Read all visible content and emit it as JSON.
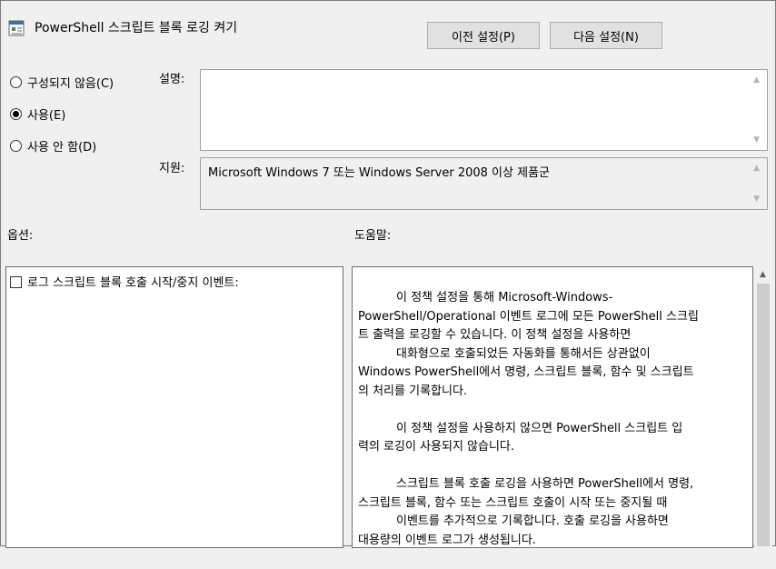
{
  "window": {
    "title": "PowerShell 스크립트 블록 로깅 켜기"
  },
  "nav": {
    "prev_label": "이전 설정(P)",
    "next_label": "다음 설정(N)"
  },
  "state": {
    "options": [
      {
        "label": "구성되지 않음(C)",
        "selected": false
      },
      {
        "label": "사용(E)",
        "selected": true
      },
      {
        "label": "사용 안 함(D)",
        "selected": false
      }
    ]
  },
  "description": {
    "label": "설명:",
    "value": ""
  },
  "support": {
    "label": "지원:",
    "value": "Microsoft Windows 7 또는 Windows Server 2008 이상 제품군"
  },
  "options_section": {
    "heading": "옵션:",
    "checkbox_label": "로그 스크립트 블록 호출 시작/중지 이벤트:",
    "checked": false
  },
  "help": {
    "heading": "도움말:",
    "p1_line1": "이 정책 설정을 통해 Microsoft-Windows-",
    "p1_line2": "PowerShell/Operational 이벤트 로그에 모든 PowerShell 스크립",
    "p1_line3": "트 출력을 로깅할 수 있습니다. 이 정책 설정을 사용하면",
    "p1_line4": "대화형으로 호출되었든 자동화를 통해서든 상관없이",
    "p1_line5": "Windows PowerShell에서 명령, 스크립트 블록, 함수 및 스크립트",
    "p1_line6": "의 처리를 기록합니다.",
    "p2_line1": "이 정책 설정을 사용하지 않으면 PowerShell 스크립트 입",
    "p2_line2": "력의 로깅이 사용되지 않습니다.",
    "p3_line1": "스크립트 블록 호출 로깅을 사용하면 PowerShell에서 명령,",
    "p3_line2": "스크립트 블록, 함수 또는 스크립트 호출이 시작 또는 중지될 때",
    "p3_line3": "이벤트를 추가적으로 기록합니다. 호출 로깅을 사용하면",
    "p3_line4": "대용량의 이벤트 로그가 생성됩니다."
  },
  "icons": {
    "policy": "policy-settings-icon",
    "scroll_up": "scroll-up-arrow-icon",
    "scroll_down": "scroll-down-arrow-icon"
  }
}
